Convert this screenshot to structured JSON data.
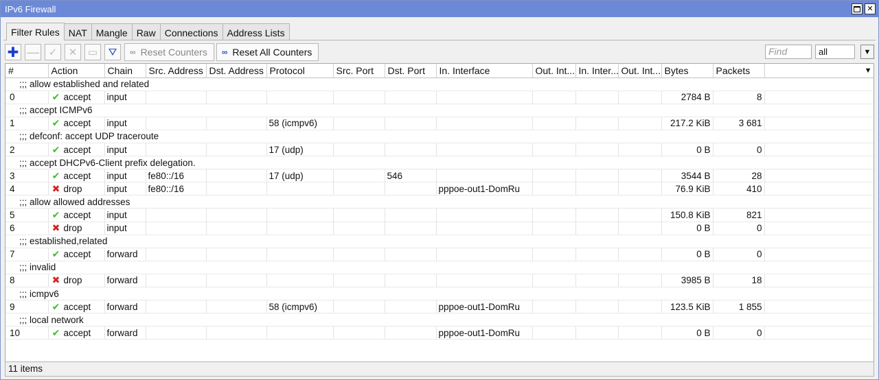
{
  "window": {
    "title": "IPv6 Firewall"
  },
  "tabs": [
    "Filter Rules",
    "NAT",
    "Mangle",
    "Raw",
    "Connections",
    "Address Lists"
  ],
  "toolbar": {
    "reset_counters": "Reset Counters",
    "reset_all_counters": "Reset All Counters",
    "find_placeholder": "Find",
    "filter_value": "all"
  },
  "columns": [
    "#",
    "Action",
    "Chain",
    "Src. Address",
    "Dst. Address",
    "Protocol",
    "Src. Port",
    "Dst. Port",
    "In. Interface",
    "Out. Int...",
    "In. Inter...",
    "Out. Int...",
    "Bytes",
    "Packets"
  ],
  "rows": [
    {
      "comment": ";;; allow established and related"
    },
    {
      "n": "0",
      "action": "accept",
      "chain": "input",
      "src": "",
      "dst": "",
      "proto": "",
      "sport": "",
      "dport": "",
      "in": "",
      "bytes": "2784 B",
      "packets": "8"
    },
    {
      "comment": ";;; accept ICMPv6"
    },
    {
      "n": "1",
      "action": "accept",
      "chain": "input",
      "src": "",
      "dst": "",
      "proto": "58 (icmpv6)",
      "sport": "",
      "dport": "",
      "in": "",
      "bytes": "217.2 KiB",
      "packets": "3 681"
    },
    {
      "comment": ";;; defconf: accept UDP traceroute"
    },
    {
      "n": "2",
      "action": "accept",
      "chain": "input",
      "src": "",
      "dst": "",
      "proto": "17 (udp)",
      "sport": "",
      "dport": "",
      "in": "",
      "bytes": "0 B",
      "packets": "0"
    },
    {
      "comment": ";;; accept DHCPv6-Client prefix delegation."
    },
    {
      "n": "3",
      "action": "accept",
      "chain": "input",
      "src": "fe80::/16",
      "dst": "",
      "proto": "17 (udp)",
      "sport": "",
      "dport": "546",
      "in": "",
      "bytes": "3544 B",
      "packets": "28"
    },
    {
      "n": "4",
      "action": "drop",
      "chain": "input",
      "src": "fe80::/16",
      "dst": "",
      "proto": "",
      "sport": "",
      "dport": "",
      "in": "pppoe-out1-DomRu",
      "bytes": "76.9 KiB",
      "packets": "410"
    },
    {
      "comment": ";;; allow allowed addresses"
    },
    {
      "n": "5",
      "action": "accept",
      "chain": "input",
      "src": "",
      "dst": "",
      "proto": "",
      "sport": "",
      "dport": "",
      "in": "",
      "bytes": "150.8 KiB",
      "packets": "821"
    },
    {
      "n": "6",
      "action": "drop",
      "chain": "input",
      "src": "",
      "dst": "",
      "proto": "",
      "sport": "",
      "dport": "",
      "in": "",
      "bytes": "0 B",
      "packets": "0"
    },
    {
      "comment": ";;; established,related"
    },
    {
      "n": "7",
      "action": "accept",
      "chain": "forward",
      "src": "",
      "dst": "",
      "proto": "",
      "sport": "",
      "dport": "",
      "in": "",
      "bytes": "0 B",
      "packets": "0"
    },
    {
      "comment": ";;; invalid"
    },
    {
      "n": "8",
      "action": "drop",
      "chain": "forward",
      "src": "",
      "dst": "",
      "proto": "",
      "sport": "",
      "dport": "",
      "in": "",
      "bytes": "3985 B",
      "packets": "18"
    },
    {
      "comment": ";;; icmpv6"
    },
    {
      "n": "9",
      "action": "accept",
      "chain": "forward",
      "src": "",
      "dst": "",
      "proto": "58 (icmpv6)",
      "sport": "",
      "dport": "",
      "in": "pppoe-out1-DomRu",
      "bytes": "123.5 KiB",
      "packets": "1 855"
    },
    {
      "comment": ";;; local network"
    },
    {
      "n": "10",
      "action": "accept",
      "chain": "forward",
      "src": "",
      "dst": "",
      "proto": "",
      "sport": "",
      "dport": "",
      "in": "pppoe-out1-DomRu",
      "bytes": "0 B",
      "packets": "0"
    }
  ],
  "status": {
    "items": "11 items"
  },
  "colors": {
    "titlebar": "#6b89d6",
    "accept": "#3cbf2d",
    "drop": "#d32525"
  }
}
